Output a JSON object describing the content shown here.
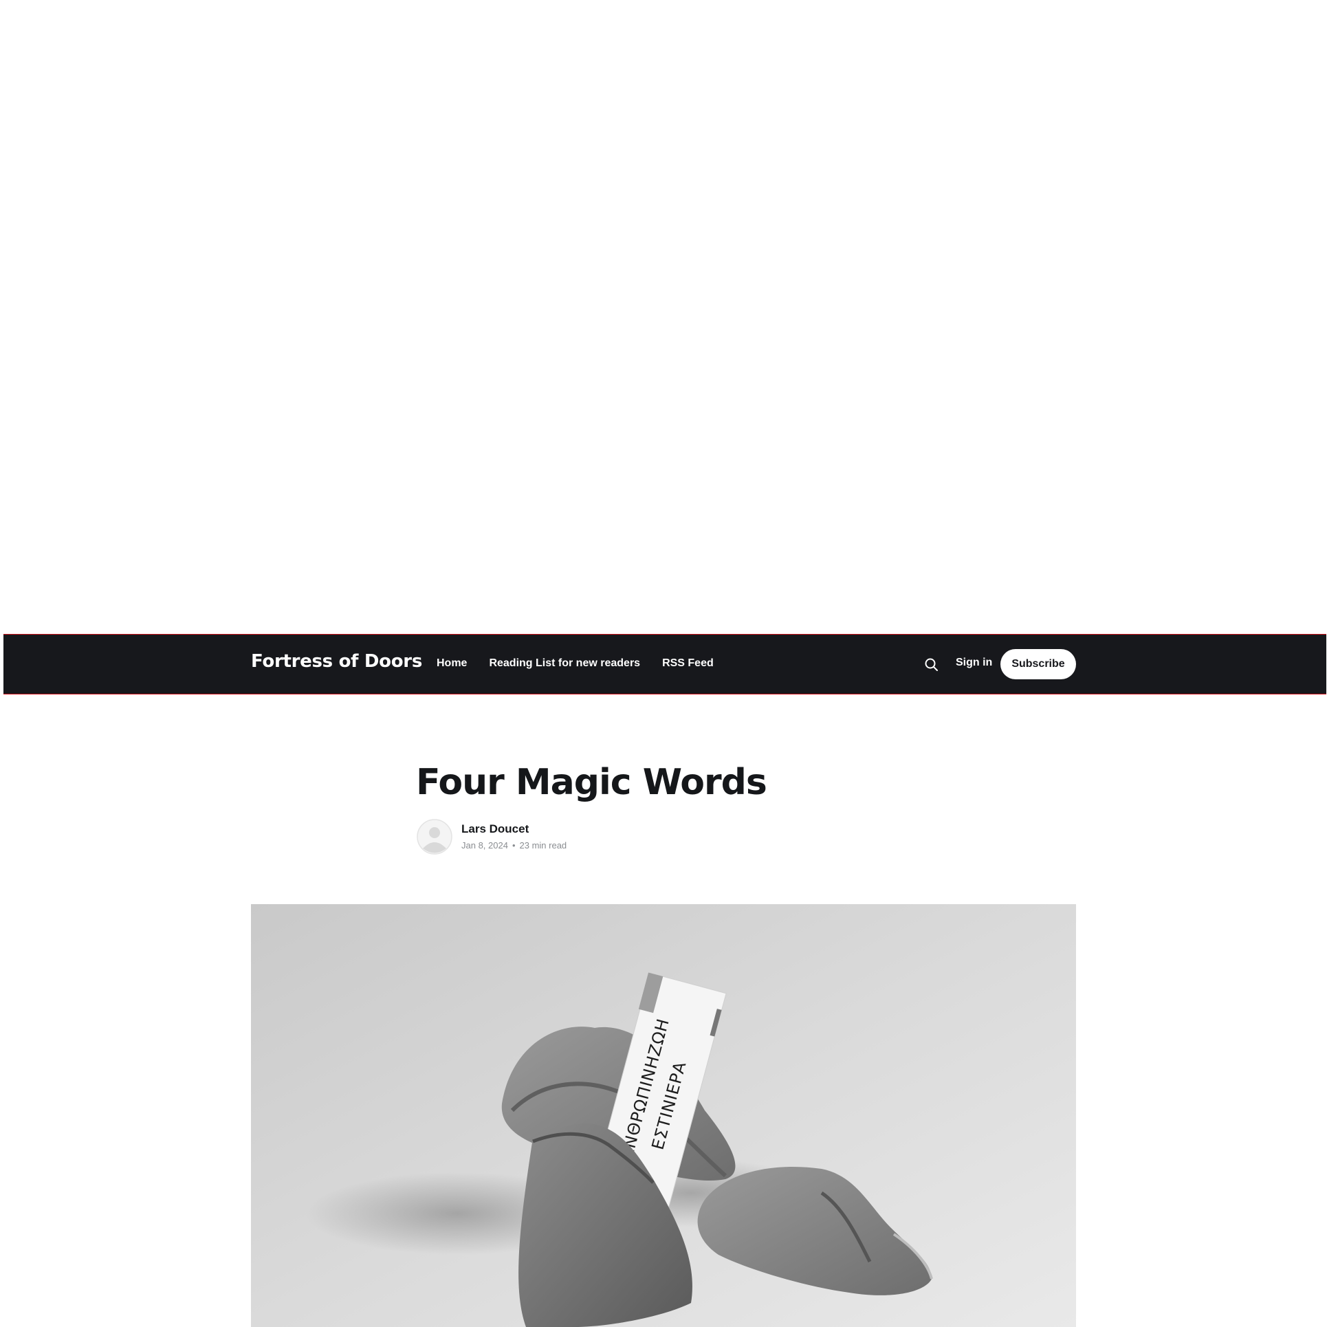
{
  "site": {
    "brand": "Fortress of Doors"
  },
  "nav": {
    "items": [
      {
        "label": "Home"
      },
      {
        "label": "Reading List for new readers"
      },
      {
        "label": "RSS Feed"
      }
    ],
    "search_icon": "search-icon",
    "signin_label": "Sign in",
    "subscribe_label": "Subscribe"
  },
  "article": {
    "title": "Four Magic Words",
    "author": "Lars Doucet",
    "date": "Jan 8, 2024",
    "separator": "•",
    "read_time": "23 min read",
    "feature_image": {
      "slip_line1": "ΗΑΝΘΡΩΠΙΝΗΖΩΗ",
      "slip_line2": "ΕΣΤΙΝΙΕΡΑ"
    }
  },
  "colors": {
    "navbar_bg": "#17181c",
    "navbar_border": "#d0121b",
    "text_dark": "#15171a",
    "meta_gray": "#8a8d91"
  }
}
